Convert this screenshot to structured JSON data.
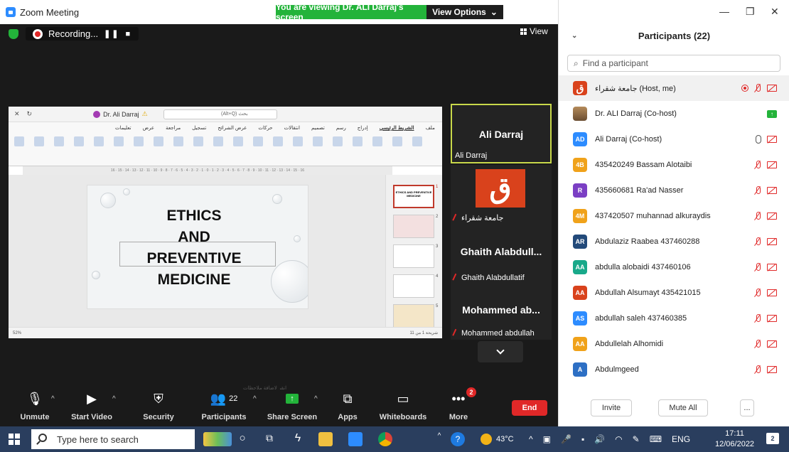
{
  "window": {
    "title": "Zoom Meeting",
    "viewing_banner": "You are viewing Dr. ALI Darraj's screen",
    "view_options": "View Options",
    "view_label": "View"
  },
  "recording": {
    "label": "Recording..."
  },
  "shared_screen": {
    "search_hint": "(Alt+Q) بحث",
    "user": "Dr. Ali Darraj",
    "tabs": [
      "ملف",
      "الشريط الرئيسي",
      "إدراج",
      "رسم",
      "تصميم",
      "انتقالات",
      "حركات",
      "عرض الشرائح",
      "تسجيل",
      "مراجعة",
      "عرض",
      "تعليمات"
    ],
    "slide_title": [
      "ETHICS",
      "AND",
      "PREVENTIVE",
      "MEDICINE"
    ],
    "notes_hint": "انقر لإضافة ملاحظات",
    "zoom": "52%",
    "slide_status": "شريحة 1 من 11",
    "thumb_numbers": [
      "1",
      "2",
      "3",
      "4",
      "5"
    ],
    "thumb_text": "ETHICS AND PREVENTIVE MEDICINE",
    "ruler": "16 · 15 · 14 · 13 · 12 · 11 · 10 · 9 · 8 · 7 · 6 · 5 · 4 · 3 · 2 · 1 · 0 · 1 · 2 · 3 · 4 · 5 · 6 · 7 · 8 · 9 · 10 · 11 · 12 · 13 · 14 · 15 · 16"
  },
  "video_tiles": [
    {
      "big": "Ali Darraj",
      "name": "Ali Darraj",
      "active": true
    },
    {
      "big": "ق",
      "name": "جامعة شقراء",
      "active": false
    },
    {
      "big": "Ghaith Alabdull...",
      "name": "Ghaith Alabdullatif",
      "active": false
    },
    {
      "big": "Mohammed ab...",
      "name": "Mohammed abdullah",
      "active": false
    }
  ],
  "toolbar": {
    "unmute": "Unmute",
    "start_video": "Start Video",
    "security": "Security",
    "participants": "Participants",
    "participants_count": "22",
    "share_screen": "Share Screen",
    "apps": "Apps",
    "whiteboards": "Whiteboards",
    "more": "More",
    "more_badge": "2",
    "end": "End"
  },
  "panel": {
    "title": "Participants (22)",
    "search_placeholder": "Find a participant",
    "invite": "Invite",
    "mute_all": "Mute All",
    "more": "...",
    "participants": [
      {
        "initials": "ق",
        "name": "جامعة شقراء (Host, me)",
        "color": "#d9421c",
        "status": "rec"
      },
      {
        "initials": "",
        "name": "Dr. ALI Darraj (Co-host)",
        "color": "#8a6a4a",
        "status": "share"
      },
      {
        "initials": "AD",
        "name": "Ali Darraj (Co-host)",
        "color": "#2d8cff",
        "status": "mic"
      },
      {
        "initials": "4B",
        "name": "435420249 Bassam Alotaibi",
        "color": "#f0a21a",
        "status": "muted"
      },
      {
        "initials": "R",
        "name": "435660681 Ra'ad Nasser",
        "color": "#7b3fc4",
        "status": "muted"
      },
      {
        "initials": "4M",
        "name": "437420507 muhannad alkuraydis",
        "color": "#f0a21a",
        "status": "muted"
      },
      {
        "initials": "AR",
        "name": "Abdulaziz Raabea 437460288",
        "color": "#234a7a",
        "status": "muted"
      },
      {
        "initials": "AA",
        "name": "abdulla alobaidi 437460106",
        "color": "#19a98a",
        "status": "muted"
      },
      {
        "initials": "AA",
        "name": "Abdullah Alsumayt 435421015",
        "color": "#d9421c",
        "status": "muted"
      },
      {
        "initials": "AS",
        "name": "abdullah saleh 437460385",
        "color": "#2d8cff",
        "status": "muted"
      },
      {
        "initials": "AA",
        "name": "Abdullelah Alhomidi",
        "color": "#f0a21a",
        "status": "muted"
      },
      {
        "initials": "A",
        "name": "Abdulmgeed",
        "color": "#2d6fc4",
        "status": "muted"
      }
    ]
  },
  "taskbar": {
    "search": "Type here to search",
    "temp": "43°C",
    "lang": "ENG",
    "time": "17:11",
    "date": "12/06/2022",
    "notif": "2"
  }
}
